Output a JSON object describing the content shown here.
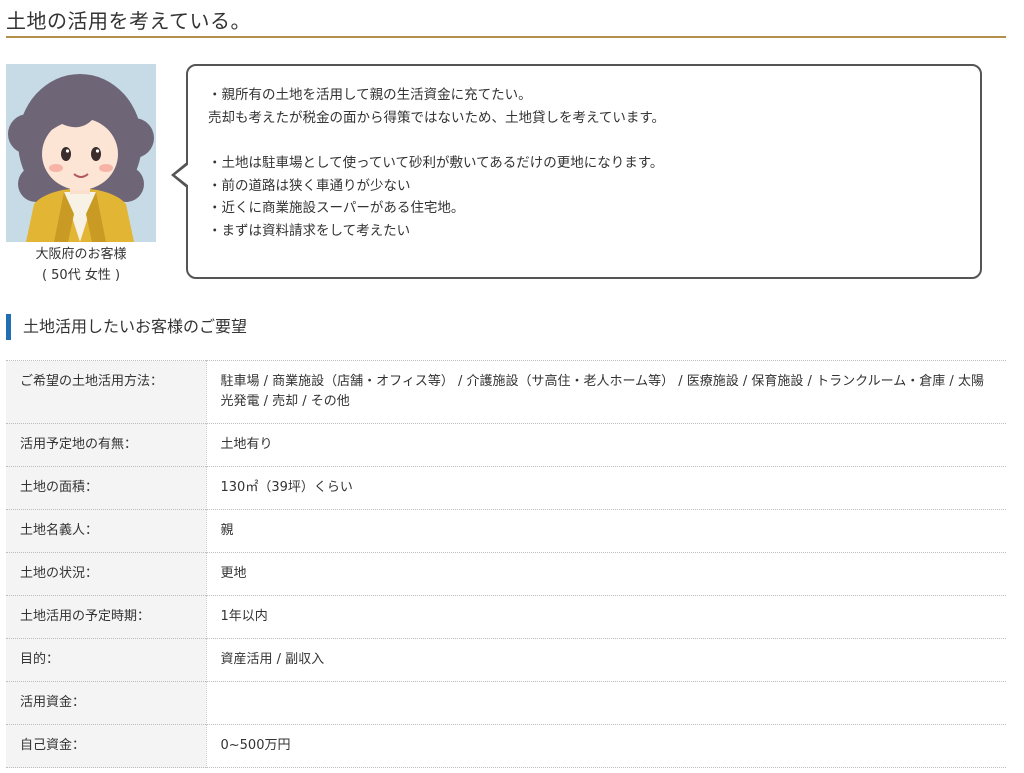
{
  "page_title": "土地の活用を考えている。",
  "customer": {
    "location": "大阪府のお客様",
    "profile": "( 50代 女性 )"
  },
  "bubble_lines": [
    "・親所有の土地を活用して親の生活資金に充てたい。",
    "売却も考えたが税金の面から得策ではないため、土地貸しを考えています。",
    "",
    "・土地は駐車場として使っていて砂利が敷いてあるだけの更地になります。",
    "・前の道路は狭く車通りが少ない",
    "・近くに商業施設スーパーがある住宅地。",
    "・まずは資料請求をして考えたい"
  ],
  "section_heading": "土地活用したいお客様のご要望",
  "requirements": [
    {
      "label": "ご希望の土地活用方法：",
      "value": "駐車場 / 商業施設（店舗・オフィス等） / 介護施設（サ高住・老人ホーム等） / 医療施設 / 保育施設 / トランクルーム・倉庫 / 太陽光発電 / 売却 / その他"
    },
    {
      "label": "活用予定地の有無：",
      "value": "土地有り"
    },
    {
      "label": "土地の面積：",
      "value": "130㎡（39坪）くらい"
    },
    {
      "label": "土地名義人：",
      "value": "親"
    },
    {
      "label": "土地の状況：",
      "value": "更地"
    },
    {
      "label": "土地活用の予定時期：",
      "value": "1年以内"
    },
    {
      "label": "目的：",
      "value": "資産活用 / 副収入"
    },
    {
      "label": "活用資金：",
      "value": ""
    },
    {
      "label": "自己資金：",
      "value": "0~500万円"
    }
  ],
  "colors": {
    "title_rule": "#b38f4a",
    "section_accent": "#1f6fb2",
    "avatar_bg": "#c7dbe7",
    "label_bg": "#f4f4f4"
  },
  "icons": {
    "avatar": "woman-avatar-illustration"
  }
}
